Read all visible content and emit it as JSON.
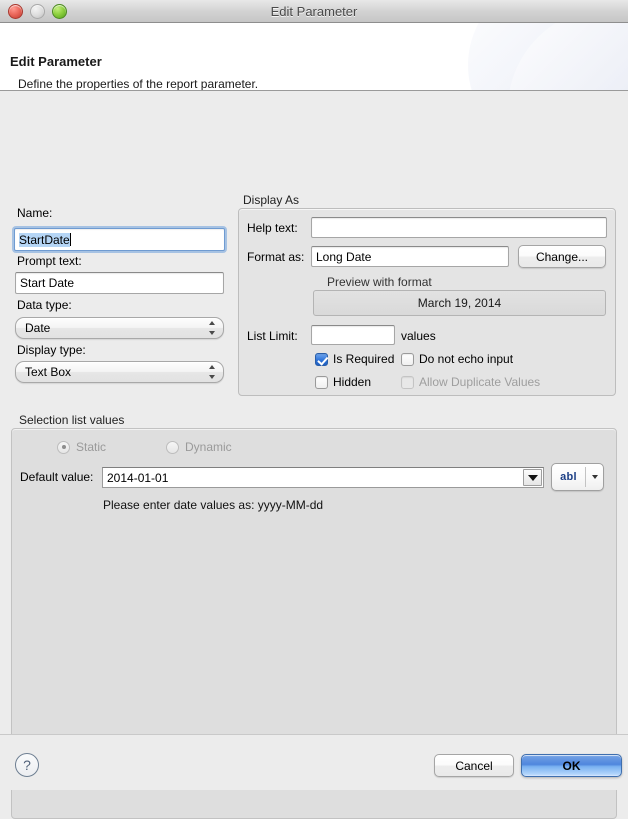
{
  "window": {
    "title": "Edit Parameter",
    "controls": [
      "close",
      "minimize",
      "zoom"
    ]
  },
  "header": {
    "title": "Edit Parameter",
    "subtitle": "Define the properties of the report parameter."
  },
  "form": {
    "name_label": "Name:",
    "name_value": "StartDate",
    "prompt_label": "Prompt text:",
    "prompt_value": "Start Date",
    "data_type_label": "Data type:",
    "data_type_value": "Date",
    "display_type_label": "Display type:",
    "display_type_value": "Text Box"
  },
  "display_as": {
    "group_title": "Display As",
    "help_text_label": "Help text:",
    "help_text_value": "",
    "format_as_label": "Format as:",
    "format_as_value": "Long Date",
    "change_button": "Change...",
    "preview_label": "Preview with format",
    "preview_value": "March 19, 2014",
    "list_limit_label": "List Limit:",
    "list_limit_value": "",
    "values_label": "values",
    "checkboxes": [
      {
        "label": "Is Required",
        "checked": true,
        "disabled": false
      },
      {
        "label": "Do not echo input",
        "checked": false,
        "disabled": false
      },
      {
        "label": "Hidden",
        "checked": false,
        "disabled": false
      },
      {
        "label": "Allow Duplicate Values",
        "checked": false,
        "disabled": true
      }
    ]
  },
  "selection_list": {
    "group_title": "Selection list values",
    "radios": [
      {
        "label": "Static",
        "selected": true,
        "disabled": true
      },
      {
        "label": "Dynamic",
        "selected": false,
        "disabled": true
      }
    ],
    "default_value_label": "Default value:",
    "default_value": "2014-01-01",
    "expression_button": "abl",
    "hint": "Please enter date values as: yyyy-MM-dd"
  },
  "footer": {
    "help_icon": "question-mark-icon",
    "cancel_button": "Cancel",
    "ok_button": "OK"
  },
  "colors": {
    "accent_blue": "#2f74d8",
    "selection_blue": "#b5d5f5",
    "default_button_blue": "#4f86dd",
    "dialog_bg": "#ececec",
    "panel_bg": "#dedede"
  }
}
